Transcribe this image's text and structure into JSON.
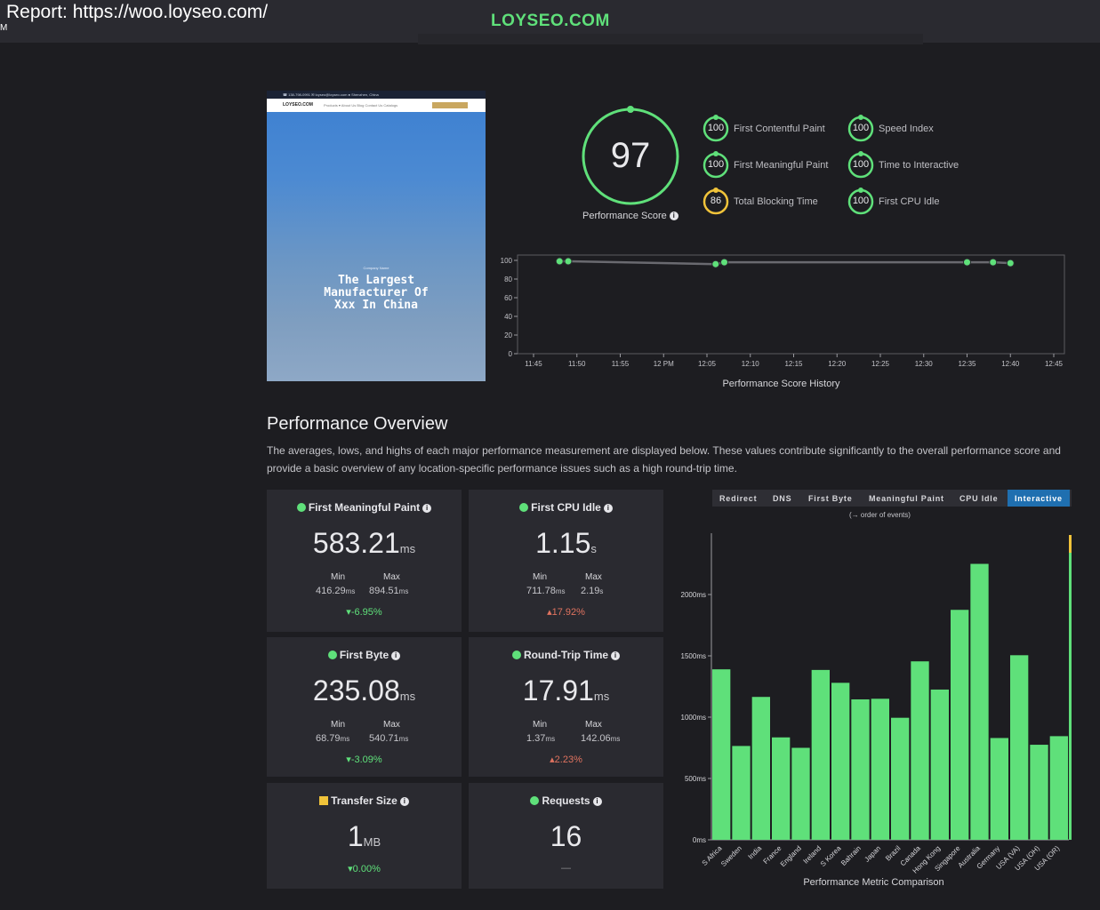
{
  "header": {
    "title": "Report: https://woo.loyseo.com/",
    "title_suffix": "M",
    "logo": "LOYSEO.COM"
  },
  "thumbnail": {
    "topbar_text": "☎ 138-798-0991   ✉ loyseo@loyseo.com   ● Shenzhen, China",
    "brand": "LOYSEO.COM",
    "nav": "Products ▾     About Us     Blog     Contact Us     Catalogs",
    "kicker": "Company Name",
    "hero_line1": "The Largest",
    "hero_line2": "Manufacturer Of",
    "hero_line3": "Xxx In China"
  },
  "performance_score": {
    "value": 97,
    "label": "Performance Score",
    "color": "#5fe07a"
  },
  "metrics": [
    {
      "value": 100,
      "label": "First Contentful Paint",
      "status": "good"
    },
    {
      "value": 100,
      "label": "First Meaningful Paint",
      "status": "good"
    },
    {
      "value": 86,
      "label": "Total Blocking Time",
      "status": "average"
    },
    {
      "value": 100,
      "label": "Speed Index",
      "status": "good"
    },
    {
      "value": 100,
      "label": "Time to Interactive",
      "status": "good"
    },
    {
      "value": 100,
      "label": "First CPU Idle",
      "status": "good"
    }
  ],
  "history_chart": {
    "title": "Performance Score History",
    "chart_data": {
      "type": "line",
      "x_ticks": [
        "11:45",
        "11:50",
        "11:55",
        "12 PM",
        "12:05",
        "12:10",
        "12:15",
        "12:20",
        "12:25",
        "12:30",
        "12:35",
        "12:40",
        "12:45"
      ],
      "y_ticks": [
        0,
        20,
        40,
        60,
        80,
        100
      ],
      "ylim": [
        0,
        100
      ],
      "x_minutes_range": [
        "11:45",
        "12:45"
      ],
      "points": [
        {
          "x": "11:48",
          "y": 99
        },
        {
          "x": "11:49",
          "y": 99
        },
        {
          "x": "12:06",
          "y": 96
        },
        {
          "x": "12:07",
          "y": 98
        },
        {
          "x": "12:35",
          "y": 98
        },
        {
          "x": "12:38",
          "y": 98
        },
        {
          "x": "12:40",
          "y": 97
        }
      ]
    }
  },
  "overview": {
    "heading": "Performance Overview",
    "description": "The averages, lows, and highs of each major performance measurement are displayed below. These values contribute significantly to the overall performance score and provide a basic overview of any location-specific performance issues such as a high round-trip time."
  },
  "cards": [
    {
      "title": "First Meaningful Paint",
      "marker": "dot",
      "value": "583.21",
      "unit": "ms",
      "min_label": "Min",
      "max_label": "Max",
      "min": "416.29",
      "min_unit": "ms",
      "max": "894.51",
      "max_unit": "ms",
      "change": "-6.95%",
      "trend": "down"
    },
    {
      "title": "First CPU Idle",
      "marker": "dot",
      "value": "1.15",
      "unit": "s",
      "min_label": "Min",
      "max_label": "Max",
      "min": "711.78",
      "min_unit": "ms",
      "max": "2.19",
      "max_unit": "s",
      "change": "17.92%",
      "trend": "up"
    },
    {
      "title": "First Byte",
      "marker": "dot",
      "value": "235.08",
      "unit": "ms",
      "min_label": "Min",
      "max_label": "Max",
      "min": "68.79",
      "min_unit": "ms",
      "max": "540.71",
      "max_unit": "ms",
      "change": "-3.09%",
      "trend": "down"
    },
    {
      "title": "Round-Trip Time",
      "marker": "dot",
      "value": "17.91",
      "unit": "ms",
      "min_label": "Min",
      "max_label": "Max",
      "min": "1.37",
      "min_unit": "ms",
      "max": "142.06",
      "max_unit": "ms",
      "change": "2.23%",
      "trend": "up"
    },
    {
      "title": "Transfer Size",
      "marker": "square",
      "value": "1",
      "unit": "MB",
      "change": "0.00%",
      "trend": "down"
    },
    {
      "title": "Requests",
      "marker": "dot",
      "value": "16",
      "unit": "",
      "change": "—",
      "trend": "flat"
    }
  ],
  "comparison": {
    "tabs": [
      "Redirect",
      "DNS",
      "First Byte",
      "Meaningful Paint",
      "CPU Idle",
      "Interactive"
    ],
    "active_tab": "Interactive",
    "order_note": "(→ order of events)",
    "title": "Performance Metric Comparison",
    "chart_data": {
      "type": "bar",
      "categories": [
        "S Africa",
        "Sweden",
        "India",
        "France",
        "England",
        "Ireland",
        "S Korea",
        "Bahrain",
        "Japan",
        "Brazil",
        "Canada",
        "Hong Kong",
        "Singapore",
        "Australia",
        "Germany",
        "USA (VA)",
        "USA (OH)",
        "USA (OR)"
      ],
      "values": [
        1390,
        765,
        1165,
        835,
        750,
        1385,
        1280,
        1145,
        1150,
        995,
        1455,
        1225,
        1875,
        2250,
        830,
        1505,
        775,
        845
      ],
      "unit": "ms",
      "y_ticks": [
        "0ms",
        "500ms",
        "1000ms",
        "1500ms",
        "2000ms"
      ],
      "ylim": [
        0,
        2500
      ],
      "bar_color": "#5fe07a"
    }
  }
}
